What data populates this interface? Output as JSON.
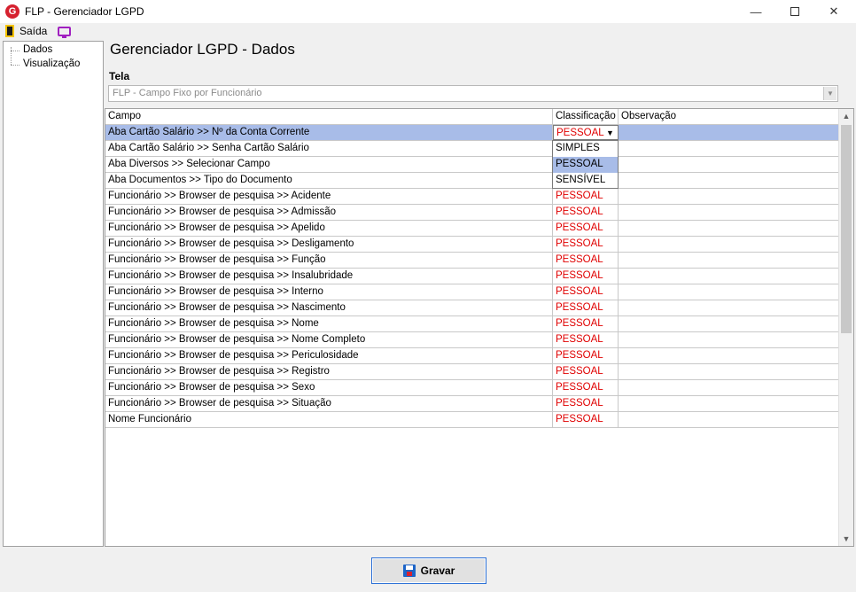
{
  "window": {
    "title": "FLP - Gerenciador LGPD",
    "app_icon_letter": "G",
    "minimize": "—",
    "close": "✕"
  },
  "menu": {
    "exit_label": "Saída"
  },
  "tree": {
    "items": [
      "Dados",
      "Visualização"
    ]
  },
  "page": {
    "title": "Gerenciador LGPD - Dados"
  },
  "tela": {
    "label": "Tela",
    "value": "FLP - Campo Fixo por Funcionário"
  },
  "grid": {
    "columns": [
      "Campo",
      "Classificação",
      "Observação"
    ],
    "rows": [
      {
        "campo": "Aba Cartão Salário >> Nº da Conta Corrente",
        "classificacao": "PESSOAL",
        "observacao": ""
      },
      {
        "campo": "Aba Cartão Salário >> Senha Cartão Salário",
        "classificacao": "",
        "observacao": ""
      },
      {
        "campo": "Aba Diversos >> Selecionar Campo",
        "classificacao": "",
        "observacao": ""
      },
      {
        "campo": "Aba Documentos >> Tipo do Documento",
        "classificacao": "",
        "observacao": ""
      },
      {
        "campo": "Funcionário >> Browser de pesquisa >> Acidente",
        "classificacao": "PESSOAL",
        "observacao": ""
      },
      {
        "campo": "Funcionário >> Browser de pesquisa >> Admissão",
        "classificacao": "PESSOAL",
        "observacao": ""
      },
      {
        "campo": "Funcionário >> Browser de pesquisa >> Apelido",
        "classificacao": "PESSOAL",
        "observacao": ""
      },
      {
        "campo": "Funcionário >> Browser de pesquisa >> Desligamento",
        "classificacao": "PESSOAL",
        "observacao": ""
      },
      {
        "campo": "Funcionário >> Browser de pesquisa >> Função",
        "classificacao": "PESSOAL",
        "observacao": ""
      },
      {
        "campo": "Funcionário >> Browser de pesquisa >> Insalubridade",
        "classificacao": "PESSOAL",
        "observacao": ""
      },
      {
        "campo": "Funcionário >> Browser de pesquisa >> Interno",
        "classificacao": "PESSOAL",
        "observacao": ""
      },
      {
        "campo": "Funcionário >> Browser de pesquisa >> Nascimento",
        "classificacao": "PESSOAL",
        "observacao": ""
      },
      {
        "campo": "Funcionário >> Browser de pesquisa >> Nome",
        "classificacao": "PESSOAL",
        "observacao": ""
      },
      {
        "campo": "Funcionário >> Browser de pesquisa >> Nome Completo",
        "classificacao": "PESSOAL",
        "observacao": ""
      },
      {
        "campo": "Funcionário >> Browser de pesquisa >> Periculosidade",
        "classificacao": "PESSOAL",
        "observacao": ""
      },
      {
        "campo": "Funcionário >> Browser de pesquisa >> Registro",
        "classificacao": "PESSOAL",
        "observacao": ""
      },
      {
        "campo": "Funcionário >> Browser de pesquisa >> Sexo",
        "classificacao": "PESSOAL",
        "observacao": ""
      },
      {
        "campo": "Funcionário >> Browser de pesquisa >> Situação",
        "classificacao": "PESSOAL",
        "observacao": ""
      },
      {
        "campo": "Nome Funcionário",
        "classificacao": "PESSOAL",
        "observacao": ""
      }
    ],
    "dropdown_options": [
      "SIMPLES",
      "PESSOAL",
      "SENSÍVEL"
    ],
    "dropdown_highlighted": "PESSOAL"
  },
  "footer": {
    "save_label": "Gravar"
  },
  "colors": {
    "selection": "#a8bce8",
    "classification_text": "#e00000",
    "button_border": "#2a6fd6"
  }
}
